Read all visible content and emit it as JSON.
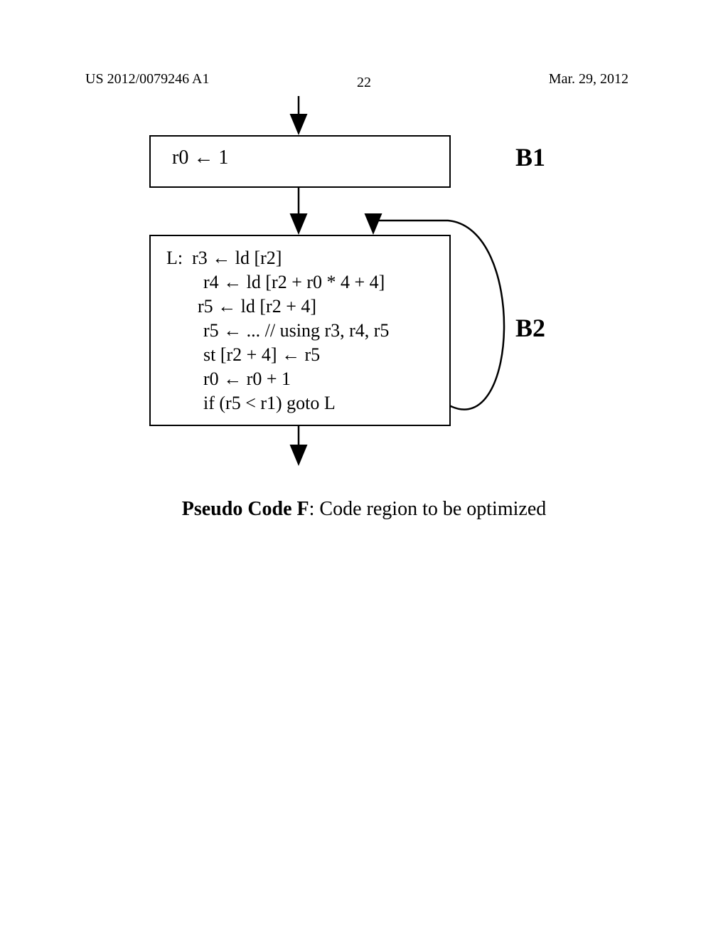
{
  "header": {
    "publication_number": "US 2012/0079246 A1",
    "page_number": "22",
    "publication_date": "Mar. 29, 2012"
  },
  "labels": {
    "b1": "B1",
    "b2": "B2"
  },
  "block_b1": {
    "line1": "r0 ← 1"
  },
  "block_b2": {
    "label_prefix": "L:",
    "line1": "r3 ← ld [r2]",
    "line2": "r4 ← ld [r2 + r0 * 4 + 4]",
    "line3": "r5 ← ld [r2 + 4]",
    "line4": "r5 ← ... // using r3, r4, r5",
    "line5": "st [r2 + 4] ← r5",
    "line6": "r0 ← r0 + 1",
    "line7": "if (r5 < r1) goto L"
  },
  "caption": {
    "bold": "Pseudo Code F",
    "rest": ": Code region to be optimized"
  }
}
